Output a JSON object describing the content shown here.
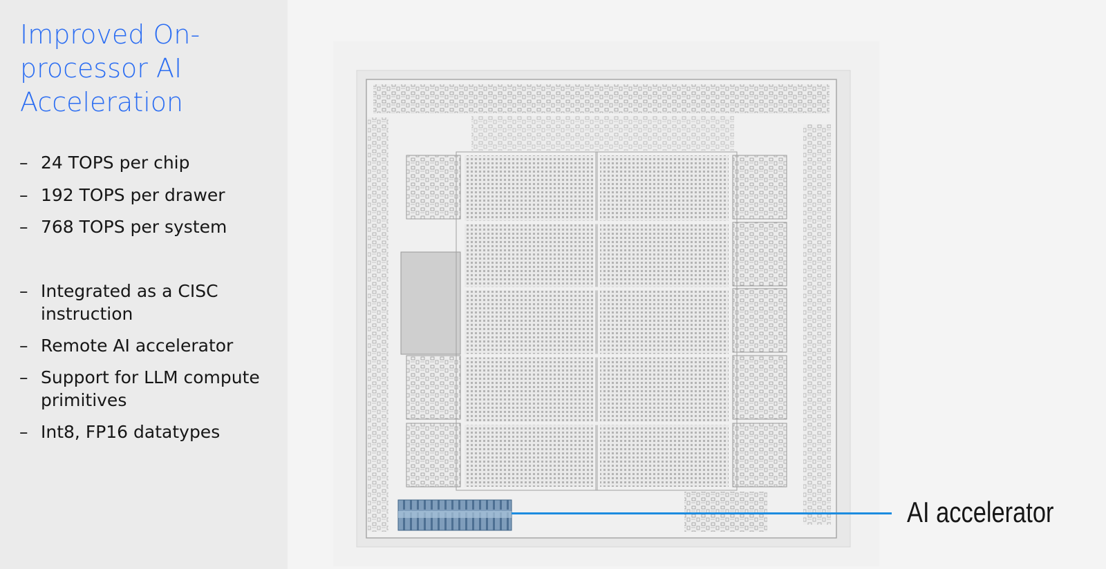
{
  "slide": {
    "title": "Improved On-processor AI Acceleration",
    "bullets": [
      "24 TOPS per chip",
      "192 TOPS per drawer",
      "768 TOPS per system",
      "Integrated as a CISC instruction",
      "Remote AI accelerator",
      "Support for LLM compute primitives",
      "Int8, FP16 datatypes"
    ],
    "bullet_marker": "–",
    "callout_label": "AI accelerator",
    "colors": {
      "title": "#2b6df2",
      "callout_line": "#1c8ce0",
      "accelerator_block": "#5f85a8"
    }
  }
}
